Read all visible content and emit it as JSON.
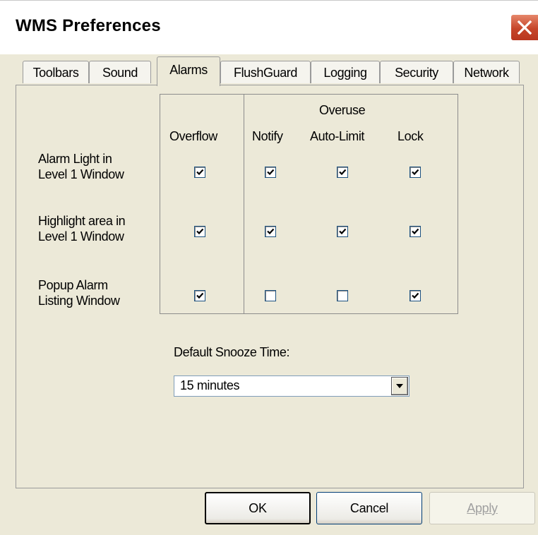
{
  "window": {
    "title": "WMS Preferences"
  },
  "tabs": [
    {
      "label": "Toolbars",
      "active": false
    },
    {
      "label": "Sound",
      "active": false
    },
    {
      "label": "Alarms",
      "active": true
    },
    {
      "label": "FlushGuard",
      "active": false
    },
    {
      "label": "Logging",
      "active": false
    },
    {
      "label": "Security",
      "active": false
    },
    {
      "label": "Network",
      "active": false
    }
  ],
  "alarms": {
    "group_header": "Overuse",
    "columns": [
      "Overflow",
      "Notify",
      "Auto-Limit",
      "Lock"
    ],
    "rows": [
      {
        "label_line1": "Alarm Light in",
        "label_line2": "Level 1 Window",
        "checks": [
          true,
          true,
          true,
          true
        ]
      },
      {
        "label_line1": "Highlight area in",
        "label_line2": "Level 1 Window",
        "checks": [
          true,
          true,
          true,
          true
        ]
      },
      {
        "label_line1": "Popup Alarm",
        "label_line2": "Listing Window",
        "checks": [
          true,
          false,
          false,
          true
        ]
      }
    ],
    "snooze_label": "Default Snooze Time:",
    "snooze_value": "15 minutes"
  },
  "buttons": {
    "ok": "OK",
    "cancel": "Cancel",
    "apply": "Apply"
  }
}
